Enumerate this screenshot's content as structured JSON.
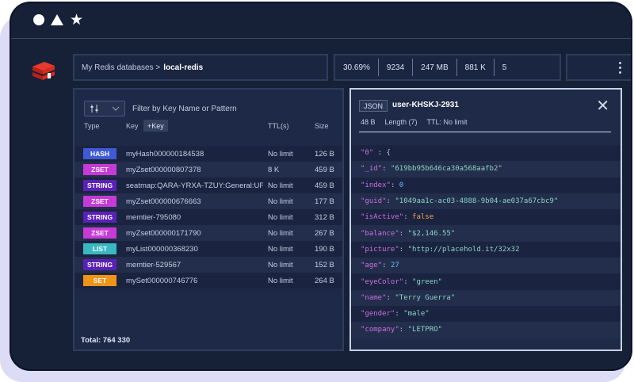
{
  "breadcrumb": {
    "prefix": "My Redis databases >",
    "current": "local-redis"
  },
  "stats": [
    "30.69%",
    "9234",
    "247 MB",
    "881 K",
    "5"
  ],
  "filter": {
    "placeholder": "Filter by Key Name or Pattern"
  },
  "columns": {
    "type": "Type",
    "key": "Key",
    "add_key": "+Key",
    "ttl": "TTL(s)",
    "size": "Size"
  },
  "rows": [
    {
      "type": "HASH",
      "color": "#3f5ad6",
      "key": "myHash000000184538",
      "ttl": "No limit",
      "size": "126 B"
    },
    {
      "type": "ZSET",
      "color": "#c83ad8",
      "key": "myZset000000807378",
      "ttl": "8 K",
      "size": "459 B"
    },
    {
      "type": "STRING",
      "color": "#5a21b8",
      "key": "seatmap:QARA-YRXA-TZUY:General:UF",
      "ttl": "No limit",
      "size": "459 B"
    },
    {
      "type": "ZSET",
      "color": "#c83ad8",
      "key": "myZset000000676663",
      "ttl": "No limit",
      "size": "177 B"
    },
    {
      "type": "STRING",
      "color": "#5a21b8",
      "key": "memtier-795080",
      "ttl": "No limit",
      "size": "312 B"
    },
    {
      "type": "ZSET",
      "color": "#c83ad8",
      "key": "myZset000000171790",
      "ttl": "No limit",
      "size": "267 B"
    },
    {
      "type": "LIST",
      "color": "#39b8c0",
      "key": "myList000000368230",
      "ttl": "No limit",
      "size": "190 B"
    },
    {
      "type": "STRING",
      "color": "#5a21b8",
      "key": "memtier-529567",
      "ttl": "No limit",
      "size": "152 B"
    },
    {
      "type": "SET",
      "color": "#f09418",
      "key": "mySet000000746776",
      "ttl": "No limit",
      "size": "264 B"
    }
  ],
  "total": "Total: 764 330",
  "detail": {
    "format": "JSON",
    "key": "user-KHSKJ-2931",
    "size": "48 B",
    "length": "Length (7)",
    "ttl": "TTL: No limit",
    "lines": [
      {
        "k": "\"0\"",
        "v": "{",
        "t": "p"
      },
      {
        "k": "\"_id\"",
        "v": "\"619bb95b646ca30a568aafb2\"",
        "t": "s"
      },
      {
        "k": "\"index\"",
        "v": "0",
        "t": "n"
      },
      {
        "k": "\"guid\"",
        "v": "\"1049aa1c-ac03-4888-9b04-ae037a67cbc9\"",
        "t": "s"
      },
      {
        "k": "\"isActive\"",
        "v": "false",
        "t": "b"
      },
      {
        "k": "\"balance\"",
        "v": "\"$2,146.55\"",
        "t": "s"
      },
      {
        "k": "\"picture\"",
        "v": "\"http://placehold.it/32x32",
        "t": "s"
      },
      {
        "k": "\"age\"",
        "v": "27",
        "t": "n"
      },
      {
        "k": "\"eyeColor\"",
        "v": "\"green\"",
        "t": "s"
      },
      {
        "k": "\"name\"",
        "v": "\"Terry Guerra\"",
        "t": "s"
      },
      {
        "k": "\"gender\"",
        "v": "\"male\"",
        "t": "s"
      },
      {
        "k": "\"company\"",
        "v": "\"LETPRO\"",
        "t": "s"
      }
    ]
  }
}
